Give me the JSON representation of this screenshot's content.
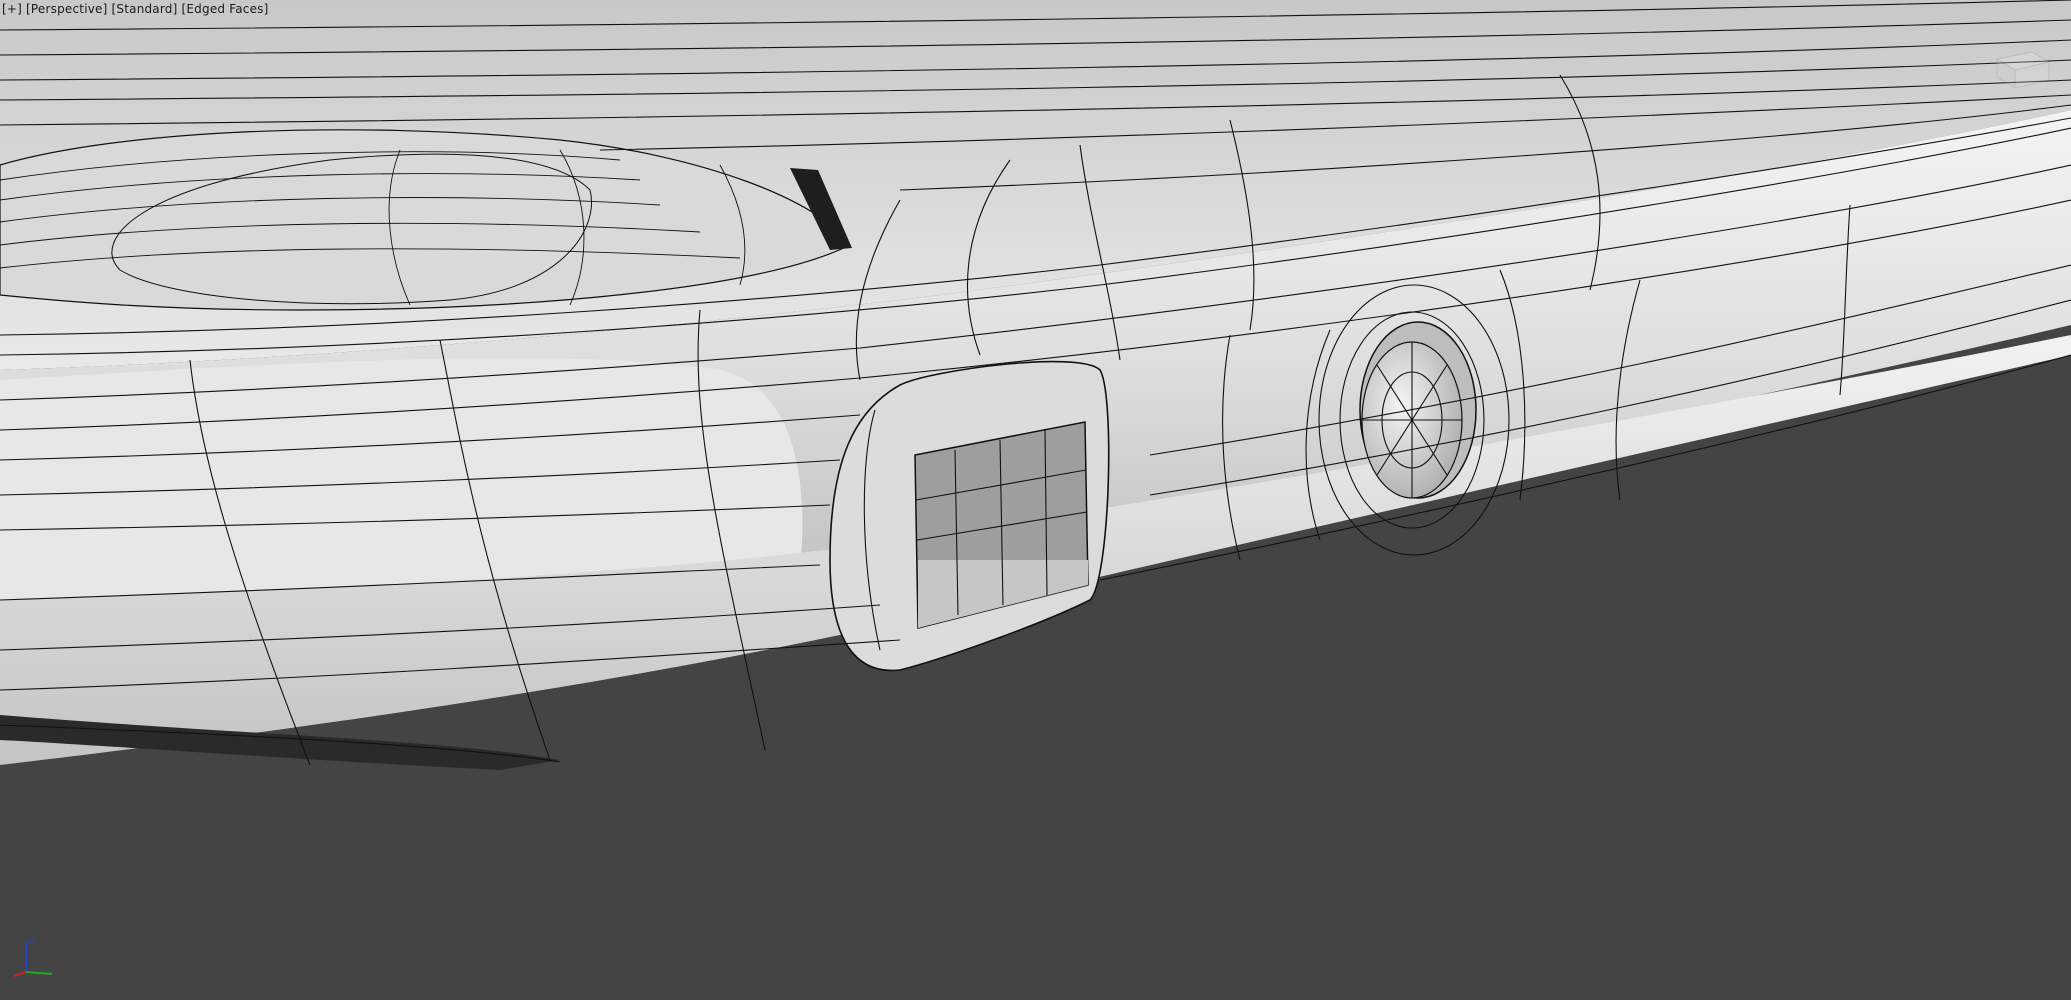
{
  "viewport": {
    "label": {
      "plus": "[+]",
      "view": "[Perspective]",
      "shading": "[Standard]",
      "mode": "[Edged Faces]"
    },
    "gizmo": {
      "z_label": "z",
      "icon": "axis-tripod-icon"
    },
    "viewcube_icon": "viewcube-icon",
    "colors": {
      "background": "#444444",
      "mesh": "#e6e6e6",
      "wire": "#111111",
      "axis_x": "#cc2222",
      "axis_y": "#22aa22",
      "axis_z": "#2244cc"
    }
  }
}
